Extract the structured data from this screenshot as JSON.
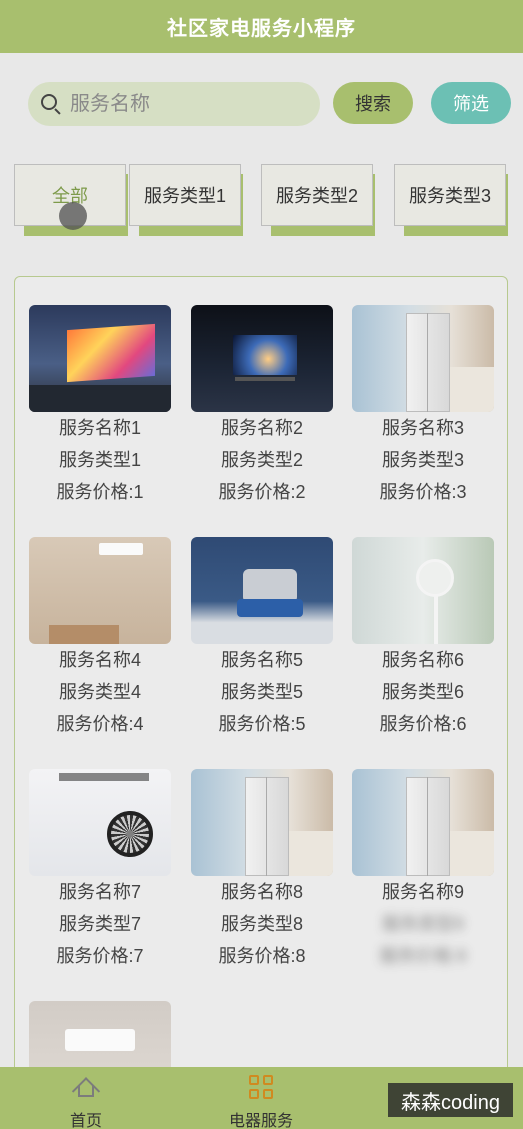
{
  "header": {
    "title": "社区家电服务小程序"
  },
  "search": {
    "placeholder": "服务名称",
    "search_label": "搜索",
    "filter_label": "筛选"
  },
  "categories": [
    "全部",
    "服务类型1",
    "服务类型2",
    "服务类型3"
  ],
  "items": [
    {
      "name": "服务名称1",
      "type": "服务类型1",
      "price": "服务价格:1",
      "image": "tv"
    },
    {
      "name": "服务名称2",
      "type": "服务类型2",
      "price": "服务价格:2",
      "image": "tv"
    },
    {
      "name": "服务名称3",
      "type": "服务类型3",
      "price": "服务价格:3",
      "image": "fridge"
    },
    {
      "name": "服务名称4",
      "type": "服务类型4",
      "price": "服务价格:4",
      "image": "air-conditioner"
    },
    {
      "name": "服务名称5",
      "type": "服务类型5",
      "price": "服务价格:5",
      "image": "cooker"
    },
    {
      "name": "服务名称6",
      "type": "服务类型6",
      "price": "服务价格:6",
      "image": "fan"
    },
    {
      "name": "服务名称7",
      "type": "服务类型7",
      "price": "服务价格:7",
      "image": "fan"
    },
    {
      "name": "服务名称8",
      "type": "服务类型8",
      "price": "服务价格:8",
      "image": "fridge"
    },
    {
      "name": "服务名称9",
      "type": "服务类型9",
      "price": "服务价格:9",
      "image": "fridge"
    },
    {
      "name": "",
      "type": "",
      "price": "",
      "image": "air-conditioner"
    }
  ],
  "tabbar": {
    "home_label": "首页",
    "service_label": "电器服务"
  },
  "watermark": "森森coding",
  "colors": {
    "primary": "#a8bf6e",
    "accent": "#6cc0b4",
    "active_icon": "#d08a20"
  }
}
